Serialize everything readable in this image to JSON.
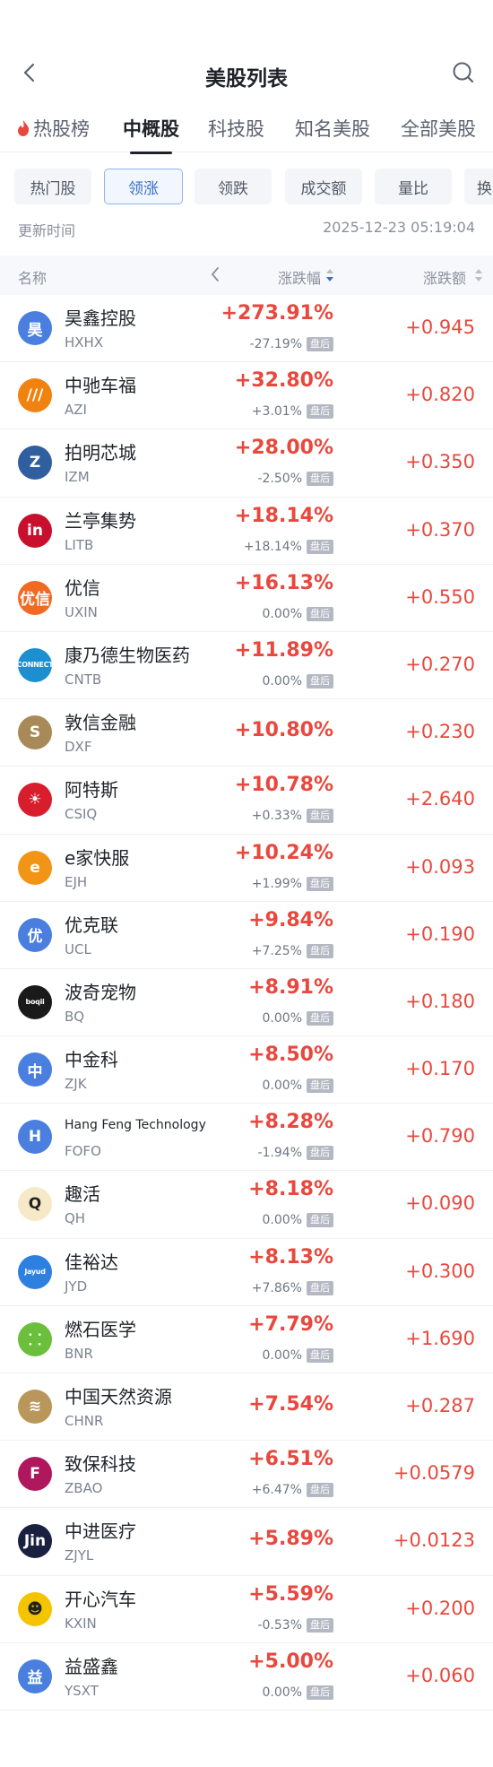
{
  "nav": {
    "title": "美股列表"
  },
  "tabs": [
    {
      "label": "热股榜"
    },
    {
      "label": "中概股"
    },
    {
      "label": "科技股"
    },
    {
      "label": "知名美股"
    },
    {
      "label": "全部美股"
    }
  ],
  "filters": [
    {
      "label": "热门股"
    },
    {
      "label": "领涨"
    },
    {
      "label": "领跌"
    },
    {
      "label": "成交额"
    },
    {
      "label": "量比"
    },
    {
      "label": "换"
    }
  ],
  "updated": {
    "label": "更新时间",
    "time": "2025-12-23 05:19:04"
  },
  "header": {
    "name": "名称",
    "change_pct": "涨跌幅",
    "change_amt": "涨跌额"
  },
  "colors": {
    "up": "#e8483d",
    "accent": "#3a6fc4",
    "badge": "#b3b8c2"
  },
  "badge_label": "盘后",
  "stocks": [
    {
      "name": "昊鑫控股",
      "ticker": "HXHX",
      "change_pct": "+273.91%",
      "after_pct": "-27.19%",
      "change_amt": "+0.945",
      "logo_text": "昊",
      "logo_color": "#4a7fe0"
    },
    {
      "name": "中驰车福",
      "ticker": "AZI",
      "change_pct": "+32.80%",
      "after_pct": "+3.01%",
      "change_amt": "+0.820",
      "logo_text": "///",
      "logo_color": "#f0820f"
    },
    {
      "name": "拍明芯城",
      "ticker": "IZM",
      "change_pct": "+28.00%",
      "after_pct": "-2.50%",
      "change_amt": "+0.350",
      "logo_text": "Z",
      "logo_color": "#2f5f9e"
    },
    {
      "name": "兰亭集势",
      "ticker": "LITB",
      "change_pct": "+18.14%",
      "after_pct": "+18.14%",
      "change_amt": "+0.370",
      "logo_text": "in",
      "logo_color": "#c8102e"
    },
    {
      "name": "优信",
      "ticker": "UXIN",
      "change_pct": "+16.13%",
      "after_pct": "0.00%",
      "change_amt": "+0.550",
      "logo_text": "优信",
      "logo_color": "#f26a21"
    },
    {
      "name": "康乃德生物医药",
      "ticker": "CNTB",
      "change_pct": "+11.89%",
      "after_pct": "0.00%",
      "change_amt": "+0.270",
      "logo_text": "CONNECT",
      "logo_color": "#1b8fd0"
    },
    {
      "name": "敦信金融",
      "ticker": "DXF",
      "change_pct": "+10.80%",
      "after_pct": "",
      "change_amt": "+0.230",
      "logo_text": "S",
      "logo_color": "#a88a58"
    },
    {
      "name": "阿特斯",
      "ticker": "CSIQ",
      "change_pct": "+10.78%",
      "after_pct": "+0.33%",
      "change_amt": "+2.640",
      "logo_text": "☀",
      "logo_color": "#d81e2c"
    },
    {
      "name": "e家快服",
      "ticker": "EJH",
      "change_pct": "+10.24%",
      "after_pct": "+1.99%",
      "change_amt": "+0.093",
      "logo_text": "e",
      "logo_color": "#f29416"
    },
    {
      "name": "优克联",
      "ticker": "UCL",
      "change_pct": "+9.84%",
      "after_pct": "+7.25%",
      "change_amt": "+0.190",
      "logo_text": "优",
      "logo_color": "#4a7fe0"
    },
    {
      "name": "波奇宠物",
      "ticker": "BQ",
      "change_pct": "+8.91%",
      "after_pct": "0.00%",
      "change_amt": "+0.180",
      "logo_text": "boqii",
      "logo_color": "#1a1a1a"
    },
    {
      "name": "中金科",
      "ticker": "ZJK",
      "change_pct": "+8.50%",
      "after_pct": "0.00%",
      "change_amt": "+0.170",
      "logo_text": "中",
      "logo_color": "#4a7fe0"
    },
    {
      "name": "Hang Feng Technology",
      "ticker": "FOFO",
      "change_pct": "+8.28%",
      "after_pct": "-1.94%",
      "change_amt": "+0.790",
      "logo_text": "H",
      "logo_color": "#4a7fe0"
    },
    {
      "name": "趣活",
      "ticker": "QH",
      "change_pct": "+8.18%",
      "after_pct": "0.00%",
      "change_amt": "+0.090",
      "logo_text": "Q",
      "logo_color": "#f5e9c8"
    },
    {
      "name": "佳裕达",
      "ticker": "JYD",
      "change_pct": "+8.13%",
      "after_pct": "+7.86%",
      "change_amt": "+0.300",
      "logo_text": "Jayud",
      "logo_color": "#2d7fe0"
    },
    {
      "name": "燃石医学",
      "ticker": "BNR",
      "change_pct": "+7.79%",
      "after_pct": "0.00%",
      "change_amt": "+1.690",
      "logo_text": "⸬",
      "logo_color": "#6cbf3c"
    },
    {
      "name": "中国天然资源",
      "ticker": "CHNR",
      "change_pct": "+7.54%",
      "after_pct": "",
      "change_amt": "+0.287",
      "logo_text": "≋",
      "logo_color": "#b9965a"
    },
    {
      "name": "致保科技",
      "ticker": "ZBAO",
      "change_pct": "+6.51%",
      "after_pct": "+6.47%",
      "change_amt": "+0.0579",
      "logo_text": "F",
      "logo_color": "#b0185e"
    },
    {
      "name": "中进医疗",
      "ticker": "ZJYL",
      "change_pct": "+5.89%",
      "after_pct": "",
      "change_amt": "+0.0123",
      "logo_text": "Jin",
      "logo_color": "#1a2040"
    },
    {
      "name": "开心汽车",
      "ticker": "KXIN",
      "change_pct": "+5.59%",
      "after_pct": "-0.53%",
      "change_amt": "+0.200",
      "logo_text": "☻",
      "logo_color": "#f5c400"
    },
    {
      "name": "益盛鑫",
      "ticker": "YSXT",
      "change_pct": "+5.00%",
      "after_pct": "0.00%",
      "change_amt": "+0.060",
      "logo_text": "益",
      "logo_color": "#4a7fe0"
    }
  ]
}
